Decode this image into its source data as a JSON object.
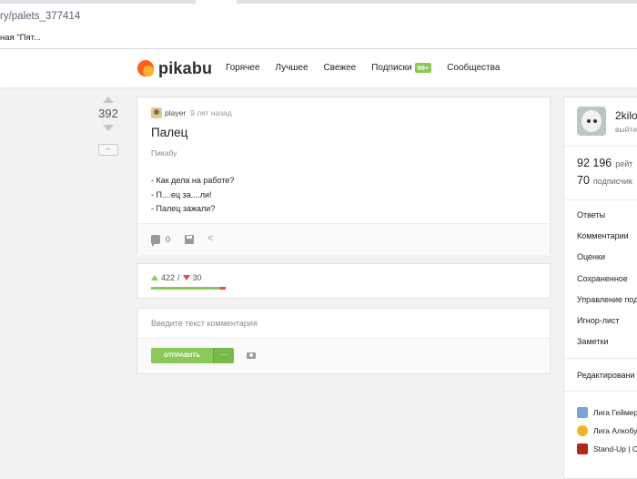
{
  "browser": {
    "url": "ry/palets_377414",
    "bookmark": "ная \"Пят..."
  },
  "header": {
    "logo": "pikabu",
    "nav": [
      "Горячее",
      "Лучшее",
      "Свежее",
      "Подписки",
      "Сообщества"
    ],
    "subs_badge": "99+"
  },
  "rating": {
    "score": "392",
    "collapse": "–"
  },
  "story": {
    "author": "player",
    "time": "9 лет назад",
    "title": "Палец",
    "tag": "Пикабу",
    "lines": [
      "- Как дела на работе?",
      "- П....ец за....ли!",
      "- Палец зажали?"
    ],
    "comments": "0"
  },
  "votes": {
    "up": "422",
    "sep": "/",
    "down": "30",
    "pluses_fraction": 0.93
  },
  "comment_form": {
    "placeholder": "Введите текст комментария",
    "send_label": "ОТПРАВИТЬ",
    "more_label": "···"
  },
  "sidebar": {
    "username": "2kilo",
    "logout": "выйти",
    "rating_value": "92 196",
    "rating_label": "рейт",
    "subs_value": "70",
    "subs_label": "подписчик",
    "links": [
      "Ответы",
      "Комментарии",
      "Оценки",
      "Сохраненное",
      "Управление под",
      "Игнор-лист",
      "Заметки"
    ],
    "edit": "Редактировани",
    "communities": [
      {
        "name": "Лига Геймер",
        "color": "#7aa3d6"
      },
      {
        "name": "Лига Алкобу",
        "color": "#f0b428"
      },
      {
        "name": "Stand-Up | С",
        "color": "#b02a1e"
      }
    ]
  }
}
